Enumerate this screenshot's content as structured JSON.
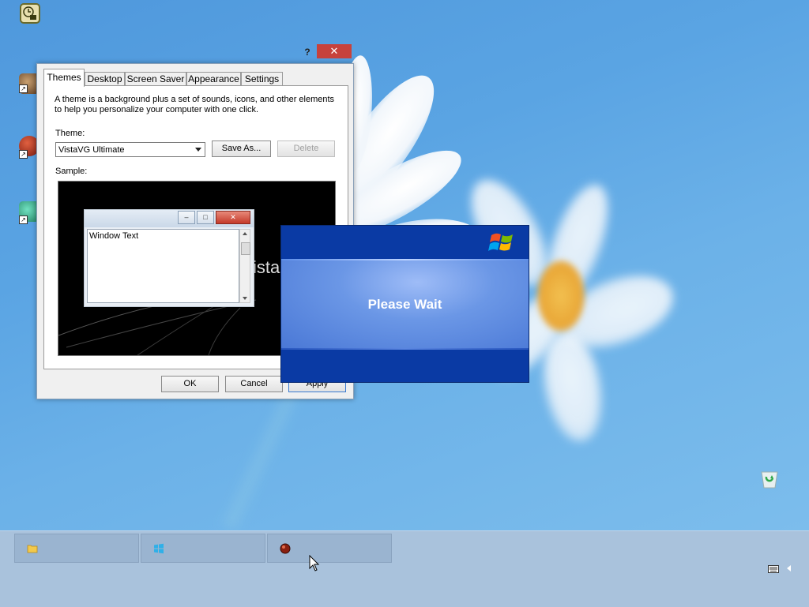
{
  "dialog": {
    "help_label": "?",
    "close_label": "✕",
    "tabs": [
      "Themes",
      "Desktop",
      "Screen Saver",
      "Appearance",
      "Settings"
    ],
    "active_tab": "Themes",
    "description": "A theme is a background plus a set of sounds, icons, and other elements to help you personalize your computer with one click.",
    "theme_label": "Theme:",
    "theme_value": "VistaVG Ultimate",
    "save_as_label": "Save As...",
    "delete_label": "Delete",
    "sample_label": "Sample:",
    "sample": {
      "window_text": "Window Text",
      "minimize_label": "–",
      "maximize_label": "□",
      "close_label": "✕",
      "background_word": "ista"
    },
    "ok_label": "OK",
    "cancel_label": "Cancel",
    "apply_label": "Apply"
  },
  "please_wait": {
    "message": "Please Wait"
  },
  "desktop": {
    "icons": [
      "clock-app-icon",
      "user-shortcut-icon",
      "ball-shortcut-icon",
      "network-shortcut-icon",
      "recycle-bin-icon"
    ]
  },
  "taskbar": {
    "buttons": [
      {
        "icon": "folder-icon"
      },
      {
        "icon": "windows-logo-icon"
      },
      {
        "icon": "red-ball-icon"
      }
    ],
    "tray": [
      "keyboard-icon",
      "chevron-left-icon"
    ]
  },
  "colors": {
    "close_red": "#c7423c",
    "xp_blue": "#07359c",
    "desktop_blue": "#5aa4e3",
    "taskbar": "#a9c2dc"
  }
}
